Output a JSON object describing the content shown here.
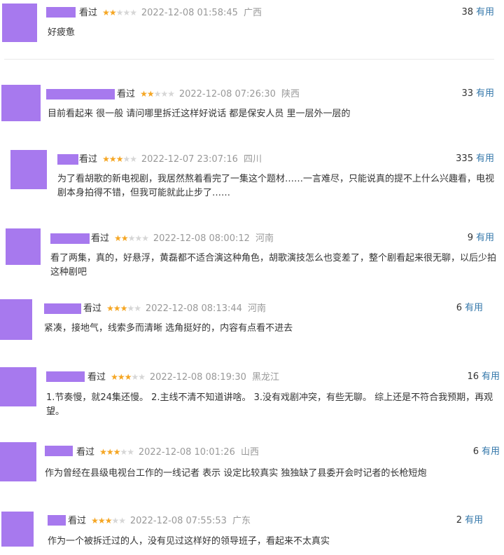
{
  "status_label": "看过",
  "useful_label": "有用",
  "colors": {
    "avatar": "#a779ee",
    "star_on": "#f5a623",
    "star_off": "#d6d6d6",
    "useful_link": "#3377aa"
  },
  "comments": [
    {
      "rating": 2,
      "time": "2022-12-08 01:58:45",
      "location": "广西",
      "votes": "38",
      "text": "好疲惫"
    },
    {
      "rating": 2,
      "time": "2022-12-08 07:26:30",
      "location": "陕西",
      "votes": "33",
      "text": "目前看起来 很一般 请问哪里拆迁这样好说话 都是保安人员 里一层外一层的"
    },
    {
      "rating": 3,
      "time": "2022-12-07 23:07:16",
      "location": "四川",
      "votes": "335",
      "text": "为了看胡歌的新电视剧，我居然熬着看完了一集这个题材……一言难尽，只能说真的提不上什么兴趣看，电视剧本身拍得不错，但我可能就此止步了……"
    },
    {
      "rating": 2,
      "time": "2022-12-08 08:00:12",
      "location": "河南",
      "votes": "9",
      "text": "看了两集，真的，好悬浮，黄磊都不适合演这种角色，胡歌演技怎么也变差了，整个剧看起来很无聊，以后少拍这种剧吧"
    },
    {
      "rating": 3,
      "time": "2022-12-08 08:13:44",
      "location": "河南",
      "votes": "6",
      "text": "紧凑，接地气，线索多而清晰 选角挺好的，内容有点看不进去"
    },
    {
      "rating": 3,
      "time": "2022-12-08 08:19:30",
      "location": "黑龙江",
      "votes": "16",
      "text": "1.节奏慢，就24集还慢。 2.主线不清不知道讲啥。 3.没有戏剧冲突，有些无聊。 综上还是不符合我预期，再观望。"
    },
    {
      "rating": 3,
      "time": "2022-12-08 10:01:26",
      "location": "山西",
      "votes": "6",
      "text": "作为曾经在县级电视台工作的一线记者 表示 设定比较真实 独独缺了县委开会时记者的长枪短炮"
    },
    {
      "rating": 3,
      "time": "2022-12-08 07:55:53",
      "location": "广东",
      "votes": "2",
      "text": "作为一个被拆迁过的人，没有见过这样好的领导班子，看起来不太真实"
    }
  ]
}
